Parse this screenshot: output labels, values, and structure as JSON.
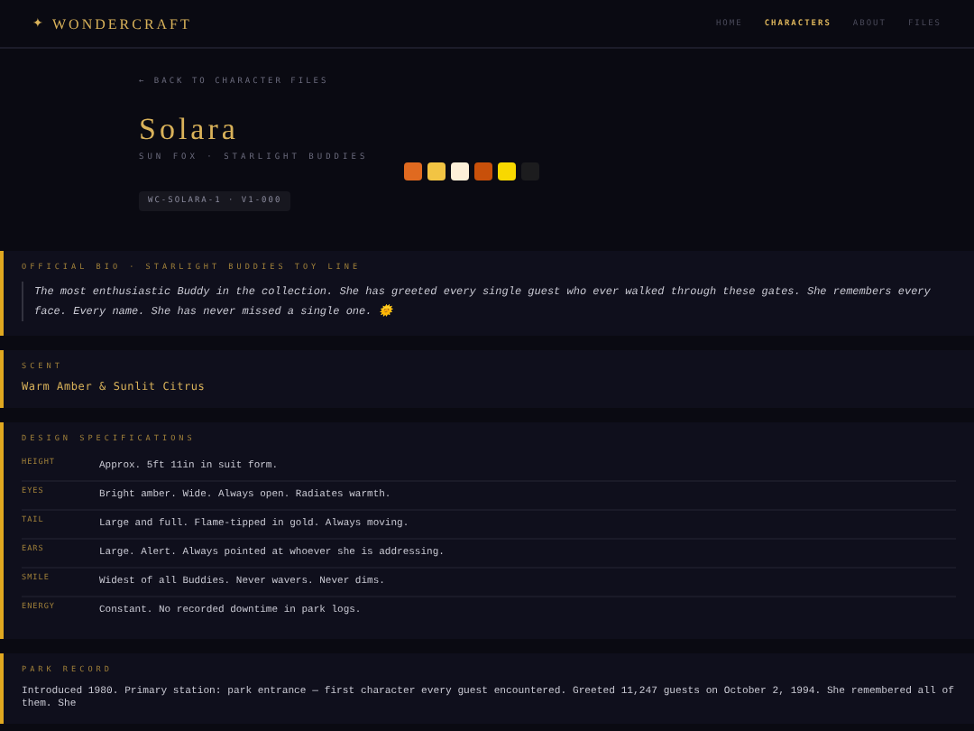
{
  "header": {
    "logo_mark": "✦",
    "logo": "WONDERCRAFT",
    "nav": [
      {
        "label": "HOME",
        "selected": false
      },
      {
        "label": "CHARACTERS",
        "selected": true
      },
      {
        "label": "ABOUT",
        "selected": false
      },
      {
        "label": "FILES",
        "selected": false
      }
    ]
  },
  "hero": {
    "back_link": "← BACK TO CHARACTER FILES",
    "name": "Solara",
    "subtitle": "SUN FOX · STARLIGHT BUDDIES",
    "swatches": [
      {
        "color": "#e06a20"
      },
      {
        "color": "#f2c443"
      },
      {
        "color": "#fdf0d8"
      },
      {
        "color": "#c8500a"
      },
      {
        "color": "#f8d800"
      },
      {
        "color": "#1c1c1e"
      }
    ],
    "tag": "WC-SOLARA-1 · V1-000"
  },
  "sections": [
    {
      "kind": "quote",
      "label": "OFFICIAL BIO · STARLIGHT BUDDIES TOY LINE",
      "text": "The most enthusiastic Buddy in the collection. She has greeted every single guest who ever walked through these gates. She remembers every face. Every name. She has never missed a single one. 🌞"
    },
    {
      "kind": "value",
      "label": "SCENT",
      "text": "Warm Amber & Sunlit Citrus"
    },
    {
      "kind": "specs",
      "label": "DESIGN SPECIFICATIONS",
      "rows": [
        {
          "key": "HEIGHT",
          "value": "Approx. 5ft 11in in suit form."
        },
        {
          "key": "EYES",
          "value": "Bright amber. Wide. Always open. Radiates warmth."
        },
        {
          "key": "TAIL",
          "value": "Large and full. Flame-tipped in gold. Always moving."
        },
        {
          "key": "EARS",
          "value": "Large. Alert. Always pointed at whoever she is addressing."
        },
        {
          "key": "SMILE",
          "value": "Widest of all Buddies. Never wavers. Never dims."
        },
        {
          "key": "ENERGY",
          "value": "Constant. No recorded downtime in park logs."
        }
      ]
    },
    {
      "kind": "text",
      "label": "PARK RECORD",
      "text": "Introduced 1980. Primary station: park entrance — first character every guest encountered. Greeted 11,247 guests on October 2, 1994. She remembered all of them. She"
    }
  ]
}
